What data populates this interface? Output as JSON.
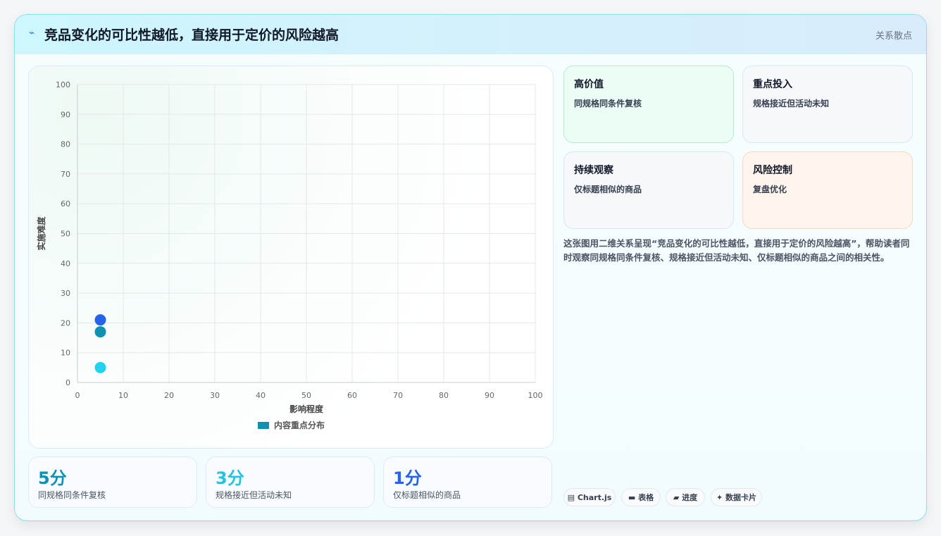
{
  "header": {
    "icon": "lightning-icon",
    "title": "竞品变化的可比性越低，直接用于定价的风险越高",
    "chart_type_label": "关系散点"
  },
  "chart_data": {
    "type": "scatter",
    "xlabel": "影响程度",
    "ylabel": "实施难度",
    "xlim": [
      0,
      100
    ],
    "ylim": [
      0,
      100
    ],
    "x_ticks": [
      "0",
      "10",
      "20",
      "30",
      "40",
      "50",
      "60",
      "70",
      "80",
      "90",
      "100"
    ],
    "y_ticks": [
      "0",
      "10",
      "20",
      "30",
      "40",
      "50",
      "60",
      "70",
      "80",
      "90",
      "100"
    ],
    "grid": true,
    "legend_position": "bottom",
    "series": [
      {
        "name": "内容重点分布",
        "color": "#0e91b3",
        "points": [
          {
            "x": 5,
            "y": 21,
            "color": "#2563eb"
          },
          {
            "x": 5,
            "y": 17,
            "color": "#0e91b3"
          },
          {
            "x": 5,
            "y": 5,
            "color": "#22d3ee"
          }
        ]
      }
    ]
  },
  "stats": [
    {
      "value": "5分",
      "label": "同规格同条件复核",
      "color": "#0e91b3"
    },
    {
      "value": "3分",
      "label": "规格接近但活动未知",
      "color": "#22c5e0"
    },
    {
      "value": "1分",
      "label": "仅标题相似的商品",
      "color": "#2563eb"
    }
  ],
  "quadrants": [
    {
      "title": "高价值",
      "subtitle": "同规格同条件复核",
      "bg": "#ecfdf5",
      "border": "#b7eccd"
    },
    {
      "title": "重点投入",
      "subtitle": "规格接近但活动未知",
      "bg": "#f6f8fb",
      "border": "#d4e9f2"
    },
    {
      "title": "持续观察",
      "subtitle": "仅标题相似的商品",
      "bg": "#f6f8fb",
      "border": "#d4e9f2"
    },
    {
      "title": "风险控制",
      "subtitle": "复盘优化",
      "bg": "#fff5ec",
      "border": "#f4d9bd"
    }
  ],
  "description": "这张图用二维关系呈现“竞品变化的可比性越低，直接用于定价的风险越高”，帮助读者同时观察同规格同条件复核、规格接近但活动未知、仅标题相似的商品之间的相关性。",
  "chips": [
    {
      "icon": "chart-icon",
      "label": "▤ Chart.js"
    },
    {
      "icon": "table-icon",
      "label": "▬ 表格"
    },
    {
      "icon": "progress-icon",
      "label": "▰ 进度"
    },
    {
      "icon": "card-icon",
      "label": "✦ 数据卡片"
    }
  ]
}
